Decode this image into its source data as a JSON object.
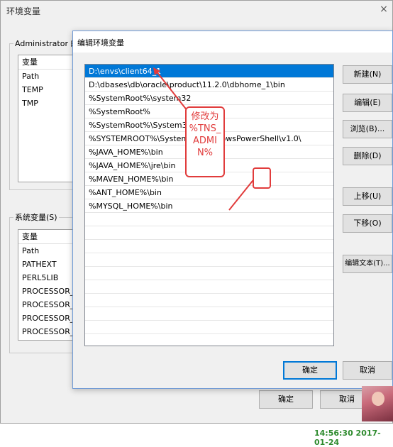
{
  "back_window": {
    "title": "环境变量",
    "close_icon": "×",
    "user_group_label": "Administrator 的",
    "user_list": {
      "header": "变量",
      "rows": [
        "Path",
        "TEMP",
        "TMP"
      ]
    },
    "system_group_label": "系统变量(S)",
    "system_list": {
      "header": "变量",
      "rows": [
        "Path",
        "PATHEXT",
        "PERL5LIB",
        "PROCESSOR_A",
        "PROCESSOR_I",
        "PROCESSOR_I",
        "PROCESSOR_I"
      ]
    },
    "ok_label": "确定",
    "cancel_label": "取消"
  },
  "dialog": {
    "title": "编辑环境变量",
    "entries": [
      "D:\\envs\\client64_1",
      "D:\\dbases\\db\\oracle\\product\\11.2.0\\dbhome_1\\bin",
      "%SystemRoot%\\system32",
      "%SystemRoot%",
      "%SystemRoot%\\System32",
      "%SYSTEMROOT%\\System32\\WindowsPowerShell\\v1.0\\",
      "%JAVA_HOME%\\bin",
      "%JAVA_HOME%\\jre\\bin",
      "%MAVEN_HOME%\\bin",
      "%ANT_HOME%\\bin",
      "%MYSQL_HOME%\\bin"
    ],
    "selected_index": 0,
    "buttons": {
      "new": "新建(N)",
      "edit": "编辑(E)",
      "browse": "浏览(B)...",
      "delete": "删除(D)",
      "move_up": "上移(U)",
      "move_down": "下移(O)",
      "edit_text": "编辑文本(T)..."
    },
    "ok_label": "确定",
    "cancel_label": "取消"
  },
  "annotation": {
    "lines": [
      "修改为",
      "%TNS_",
      "ADMI",
      "N%"
    ],
    "color": "#e13c3c"
  },
  "timestamp": "14:56:30 2017-01-24"
}
